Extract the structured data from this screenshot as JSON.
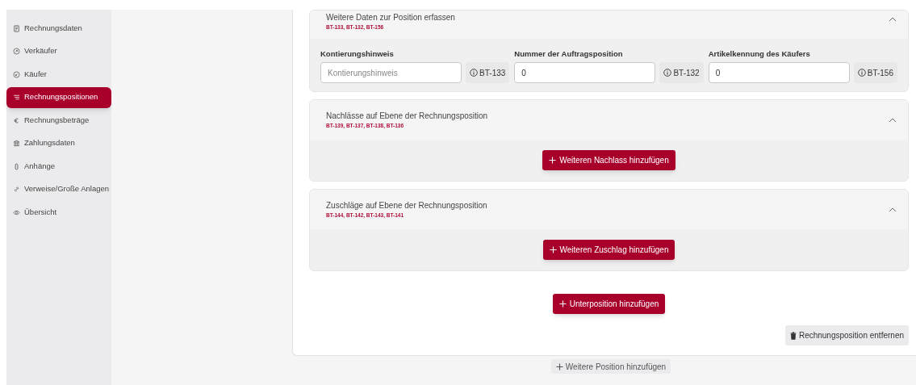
{
  "sidebar": {
    "items": [
      {
        "label": "Rechnungsdaten",
        "selected": false
      },
      {
        "label": "Verkäufer",
        "selected": false
      },
      {
        "label": "Käufer",
        "selected": false
      },
      {
        "label": "Rechnungspositionen",
        "selected": true
      },
      {
        "label": "Rechnungsbeträge",
        "selected": false
      },
      {
        "label": "Zahlungsdaten",
        "selected": false
      },
      {
        "label": "Anhänge",
        "selected": false
      },
      {
        "label": "Verweise/Große Anlagen",
        "selected": false
      },
      {
        "label": "Übersicht",
        "selected": false
      }
    ]
  },
  "sections": [
    {
      "kind": "fields",
      "title": "Weitere Daten zur Position erfassen",
      "codes": "BT-133, BT-132, BT-156",
      "expanded": true,
      "fields": [
        {
          "label": "Kontierungshinweis",
          "placeholder": "Kontierungshinweis",
          "hint": "BT-133"
        },
        {
          "label": "Nummer der Auftragsposition",
          "value": "0",
          "hint": "BT-132"
        },
        {
          "label": "Artikelkennung des Käufers",
          "value": "0",
          "hint": "BT-156"
        }
      ]
    },
    {
      "kind": "button",
      "title": "Nachlässe auf Ebene der Rechnungsposition",
      "codes": "BT-139, BT-137, BT-138, BT-136",
      "expanded": true,
      "button": "Weiteren Nachlass hinzufügen"
    },
    {
      "kind": "button",
      "title": "Zuschläge auf Ebene der Rechnungsposition",
      "codes": "BT-144, BT-142, BT-143, BT-141",
      "expanded": true,
      "button": "Weiteren Zuschlag hinzufügen"
    }
  ],
  "add_subposition_button": "Unterposition hinzufügen",
  "remove_position_button": "Rechnungsposition entfernen",
  "add_position_button": "Weitere Position hinzufügen"
}
